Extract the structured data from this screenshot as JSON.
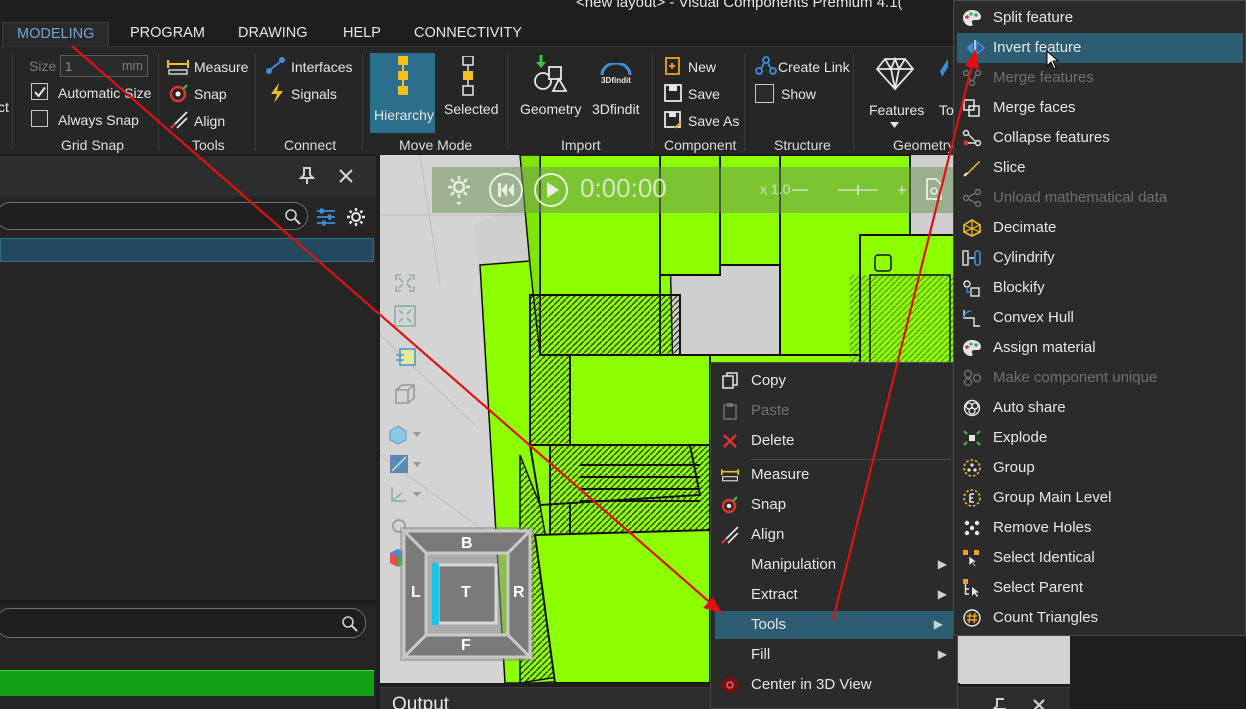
{
  "window": {
    "title": "<new layout> - Visual Components Premium 4.1("
  },
  "tabs": [
    "MODELING",
    "PROGRAM",
    "DRAWING",
    "HELP",
    "CONNECTIVITY"
  ],
  "ribbon": {
    "grid_snap": {
      "size_label": "Size",
      "size_value": "1",
      "size_unit": "mm",
      "automatic_size": "Automatic Size",
      "always_snap": "Always Snap",
      "title": "Grid Snap",
      "cut_text": "ct"
    },
    "tools": {
      "measure": "Measure",
      "snap": "Snap",
      "align": "Align",
      "title": "Tools"
    },
    "connect": {
      "interfaces": "Interfaces",
      "signals": "Signals",
      "title": "Connect"
    },
    "move_mode": {
      "hierarchy": "Hierarchy",
      "selected": "Selected",
      "title": "Move Mode"
    },
    "import": {
      "geometry": "Geometry",
      "threedfindit": "3Dfindit",
      "title": "Import"
    },
    "component": {
      "new": "New",
      "save": "Save",
      "save_as": "Save As",
      "title": "Component"
    },
    "structure": {
      "create_link": "Create Link",
      "show": "Show",
      "title": "Structure"
    },
    "geometry": {
      "features": "Features",
      "cut_tool": "To",
      "title": "Geometry"
    }
  },
  "viewport": {
    "time": "0:00:00",
    "speed": "x 1.0",
    "navcube": {
      "back": "B",
      "top": "T",
      "left": "L",
      "right": "R",
      "front": "F"
    }
  },
  "output": {
    "title": "Output"
  },
  "context_menu": {
    "items": [
      {
        "label": "Copy",
        "icon": "copy-icon"
      },
      {
        "label": "Paste",
        "icon": "paste-icon",
        "disabled": true
      },
      {
        "label": "Delete",
        "icon": "delete-icon"
      },
      {
        "label": "Measure",
        "icon": "measure-icon"
      },
      {
        "label": "Snap",
        "icon": "snap-icon"
      },
      {
        "label": "Align",
        "icon": "align-icon"
      },
      {
        "label": "Manipulation",
        "submenu": true
      },
      {
        "label": "Extract",
        "submenu": true
      },
      {
        "label": "Tools",
        "submenu": true,
        "highlighted": true
      },
      {
        "label": "Fill",
        "submenu": true
      },
      {
        "label": "Center in 3D View",
        "icon": "center-icon"
      }
    ]
  },
  "tools_submenu": {
    "items": [
      {
        "label": "Split feature",
        "icon": "palette-icon"
      },
      {
        "label": "Invert feature",
        "icon": "invert-icon",
        "highlighted": true
      },
      {
        "label": "Merge features",
        "icon": "merge-features-icon",
        "disabled": true
      },
      {
        "label": "Merge faces",
        "icon": "merge-faces-icon"
      },
      {
        "label": "Collapse features",
        "icon": "collapse-icon"
      },
      {
        "label": "Slice",
        "icon": "slice-icon"
      },
      {
        "label": "Unload mathematical data",
        "icon": "unload-icon",
        "disabled": true
      },
      {
        "label": "Decimate",
        "icon": "decimate-icon"
      },
      {
        "label": "Cylindrify",
        "icon": "cylindrify-icon"
      },
      {
        "label": "Blockify",
        "icon": "blockify-icon"
      },
      {
        "label": "Convex Hull",
        "icon": "convex-hull-icon"
      },
      {
        "label": "Assign material",
        "icon": "material-icon"
      },
      {
        "label": "Make component unique",
        "icon": "unique-icon",
        "disabled": true
      },
      {
        "label": "Auto share",
        "icon": "auto-share-icon"
      },
      {
        "label": "Explode",
        "icon": "explode-icon"
      },
      {
        "label": "Group",
        "icon": "group-icon"
      },
      {
        "label": "Group Main Level",
        "icon": "group-main-level-icon"
      },
      {
        "label": "Remove Holes",
        "icon": "remove-holes-icon"
      },
      {
        "label": "Select Identical",
        "icon": "select-identical-icon"
      },
      {
        "label": "Select Parent",
        "icon": "select-parent-icon"
      },
      {
        "label": "Count Triangles",
        "icon": "count-triangles-icon"
      }
    ]
  },
  "colors": {
    "accent": "#2d5d72",
    "annotation_arrow": "#e01010",
    "model_green": "#8cff00"
  }
}
